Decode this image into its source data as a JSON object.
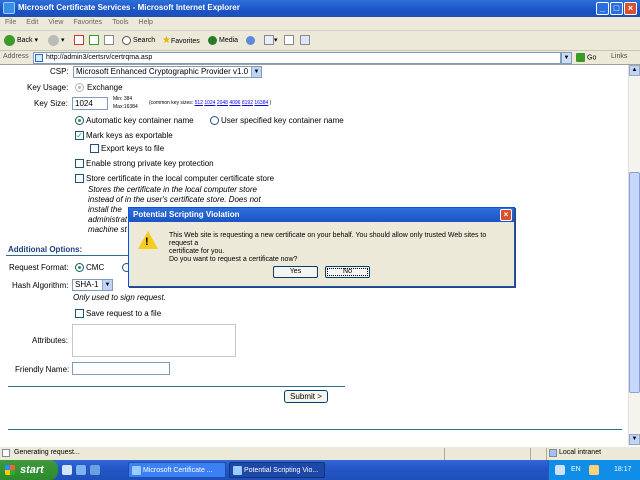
{
  "window": {
    "title": "Microsoft Certificate Services - Microsoft Internet Explorer",
    "minimize_glyph": "_",
    "maximize_glyph": "□",
    "close_glyph": "×"
  },
  "menu": [
    "File",
    "Edit",
    "View",
    "Favorites",
    "Tools",
    "Help"
  ],
  "toolbar": {
    "back": "Back",
    "search": "Search",
    "favorites": "Favorites",
    "media": "Media"
  },
  "address": {
    "label": "Address",
    "url": "http://admin3/certsrv/certrqma.asp",
    "go": "Go",
    "links": "Links"
  },
  "form": {
    "csp_label": "CSP:",
    "csp_value": "Microsoft Enhanced Cryptographic Provider v1.0",
    "key_usage_label": "Key Usage:",
    "key_usage_value": "Exchange",
    "key_size_label": "Key Size:",
    "key_size_value": "1024",
    "key_min": "Min:       384",
    "key_max": "Max:16384",
    "key_common": "(common key sizes:",
    "key_common_sizes": [
      "512",
      "1024",
      "2048",
      "4096",
      "8192",
      "16384"
    ],
    "key_common_close": ")",
    "auto_container": "Automatic key container name",
    "user_container": "User specified key container name",
    "mark_exportable": "Mark keys as exportable",
    "export_to_file": "Export keys to file",
    "strong_protection": "Enable strong private key protection",
    "store_local": "Store certificate in the local computer certificate store",
    "store_hint": [
      "Stores the certificate in the local computer store",
      "instead of in the user's certificate store. Does not",
      "install the",
      "administrat",
      "machine st"
    ],
    "additional_options": "Additional Options:",
    "request_format_label": "Request Format:",
    "request_format_cmc": "CMC",
    "hash_label": "Hash Algorithm:",
    "hash_value": "SHA-1",
    "hash_hint": "Only used to sign request.",
    "save_request": "Save request to a file",
    "attributes_label": "Attributes:",
    "friendly_name_label": "Friendly Name:",
    "submit": "Submit >"
  },
  "dialog": {
    "title": "Potential Scripting Violation",
    "message_line1": "This Web site is requesting a new certificate on your behalf. You should allow only trusted Web sites to request a",
    "message_line2": "certificate for you.",
    "message_line3": "Do you want to request a certificate now?",
    "yes": "Yes",
    "no": "No",
    "close_glyph": "×"
  },
  "status": {
    "text": "Generating request...",
    "zone": "Local intranet"
  },
  "taskbar": {
    "start": "start",
    "tasks": [
      "Microsoft Certificate ...",
      "Potential Scripting Vio..."
    ],
    "language": "EN",
    "clock": "18:17"
  },
  "colors": {
    "xp_blue": "#1b54c4",
    "start_green": "#3c9a3c",
    "link_blue": "#0000ee"
  }
}
